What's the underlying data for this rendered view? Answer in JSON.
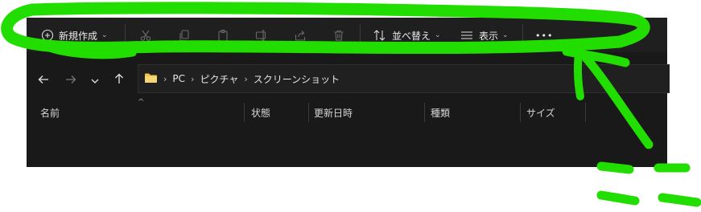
{
  "toolbar": {
    "new_label": "新規作成",
    "sort_label": "並べ替え",
    "view_label": "表示",
    "more_label": "•••"
  },
  "address": {
    "segments": [
      "PC",
      "ピクチャ",
      "スクリーンショット"
    ]
  },
  "columns": [
    "名前",
    "状態",
    "更新日時",
    "種類",
    "サイズ"
  ],
  "colors": {
    "window_bg": "#191919",
    "annotation": "#22dd00",
    "folder": "#f0c44c"
  }
}
